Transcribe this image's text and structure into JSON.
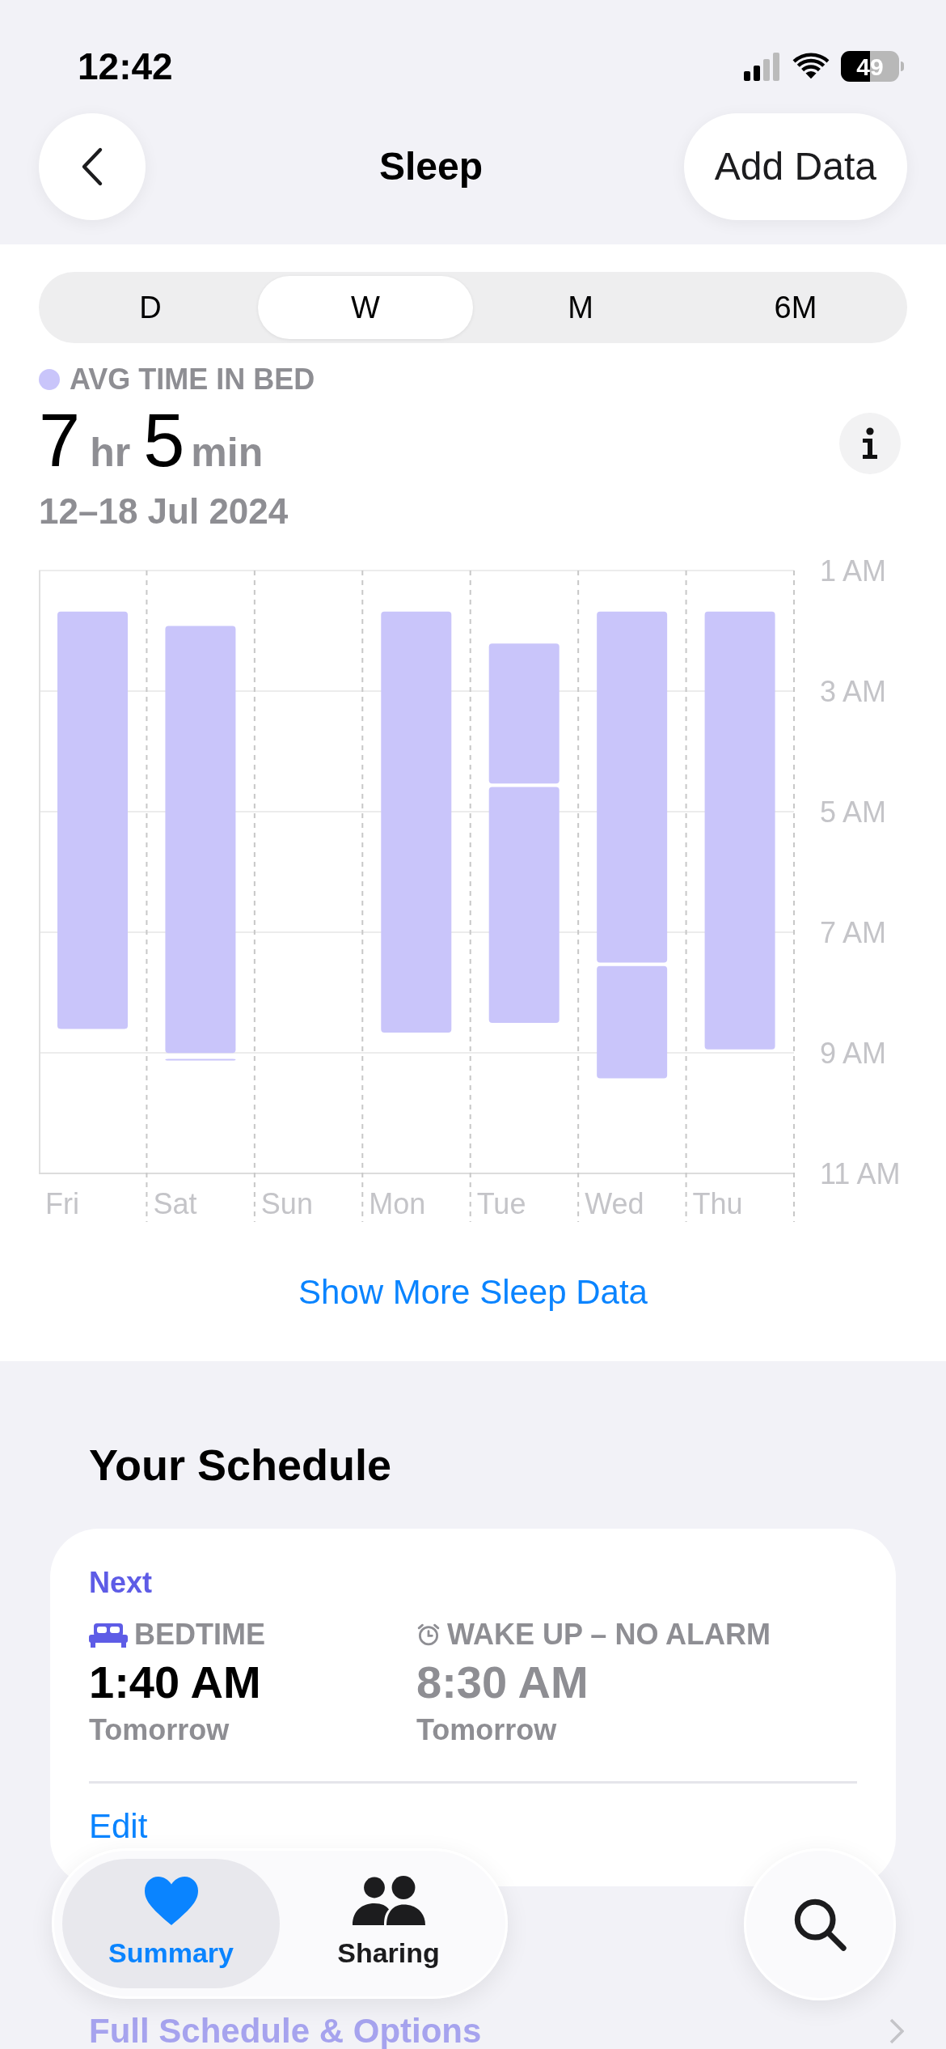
{
  "status_bar": {
    "time": "12:42",
    "battery": "49"
  },
  "nav": {
    "title": "Sleep",
    "action": "Add Data"
  },
  "tabs": [
    {
      "label": "D",
      "selected": false
    },
    {
      "label": "W",
      "selected": true
    },
    {
      "label": "M",
      "selected": false
    },
    {
      "label": "6M",
      "selected": false
    }
  ],
  "summary": {
    "legend": "AVG TIME IN BED",
    "hours": "7",
    "hours_unit": "hr",
    "minutes": "5",
    "minutes_unit": "min",
    "date_range": "12–18 Jul 2024"
  },
  "chart_data": {
    "type": "candlestick",
    "grid": true,
    "categories": [
      "Fri",
      "Sat",
      "Sun",
      "Mon",
      "Tue",
      "Wed",
      "Thu"
    ],
    "series": [
      {
        "color": "#c9c5fa",
        "ohlc": [
          [
            1.68,
            8.63,
            1.68,
            8.63
          ],
          [
            1.92,
            9.03,
            1.92,
            9.03
          ],
          null,
          [
            1.68,
            8.69,
            1.68,
            8.69
          ],
          [
            2.21,
            4.56,
            2.21,
            4.56
          ],
          [
            1.68,
            7.53,
            1.68,
            7.53
          ],
          [
            1.68,
            8.97,
            1.68,
            8.97
          ]
        ]
      },
      {
        "color": "#c9c5fa",
        "ohlc": [
          null,
          [
            9.1,
            9.12,
            9.1,
            9.12
          ],
          null,
          null,
          [
            4.59,
            8.53,
            4.59,
            8.53
          ],
          [
            7.56,
            9.45,
            7.56,
            9.45
          ],
          null
        ]
      }
    ],
    "ylim": [
      11,
      1
    ],
    "yticks": [
      {
        "value": 1,
        "label": "1 AM"
      },
      {
        "value": 3,
        "label": "3 AM"
      },
      {
        "value": 5,
        "label": "5 AM"
      },
      {
        "value": 7,
        "label": "7 AM"
      },
      {
        "value": 9,
        "label": "9 AM"
      },
      {
        "value": 11,
        "label": "11 AM"
      }
    ]
  },
  "more_link": "Show More Sleep Data",
  "schedule": {
    "title": "Your Schedule",
    "next_label": "Next",
    "items": [
      {
        "kind": "bedtime",
        "label": "BEDTIME",
        "time": "1:40 AM",
        "day": "Tomorrow",
        "dimmed": false
      },
      {
        "kind": "wake",
        "label": "WAKE UP – NO ALARM",
        "time": "8:30 AM",
        "day": "Tomorrow",
        "dimmed": true
      }
    ],
    "edit": "Edit",
    "options": "Full Schedule & Options"
  },
  "bottom_tabs": [
    {
      "kind": "heart",
      "label": "Summary",
      "selected": true
    },
    {
      "kind": "people",
      "label": "Sharing",
      "selected": false
    }
  ]
}
